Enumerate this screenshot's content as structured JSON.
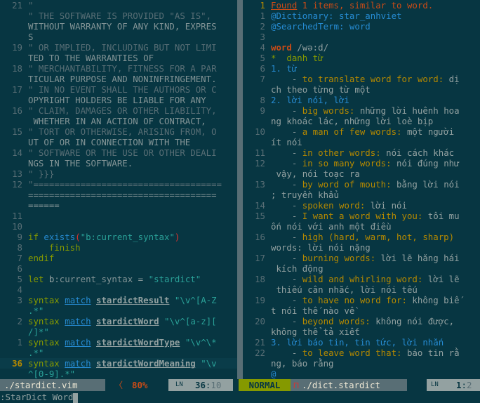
{
  "left": {
    "lines": [
      {
        "n": "21",
        "t": "\""
      },
      {
        "n": "",
        "t": "\" THE SOFTWARE IS PROVIDED \"AS IS\", "
      },
      {
        "n": "",
        "t": "WITHOUT WARRANTY OF ANY KIND, EXPRES"
      },
      {
        "n": "",
        "t": "S"
      },
      {
        "n": "19",
        "t": "\" OR IMPLIED, INCLUDING BUT NOT LIMI"
      },
      {
        "n": "",
        "t": "TED TO THE WARRANTIES OF"
      },
      {
        "n": "18",
        "t": "\" MERCHANTABILITY, FITNESS FOR A PAR"
      },
      {
        "n": "",
        "t": "TICULAR PURPOSE AND NONINFRINGEMENT."
      },
      {
        "n": "17",
        "t": "\" IN NO EVENT SHALL THE AUTHORS OR C"
      },
      {
        "n": "",
        "t": "OPYRIGHT HOLDERS BE LIABLE FOR ANY"
      },
      {
        "n": "16",
        "t": "\" CLAIM, DAMAGES OR OTHER LIABILITY,"
      },
      {
        "n": "",
        "t": " WHETHER IN AN ACTION OF CONTRACT,"
      },
      {
        "n": "15",
        "t": "\" TORT OR OTHERWISE, ARISING FROM, O"
      },
      {
        "n": "",
        "t": "UT OF OR IN CONNECTION WITH THE"
      },
      {
        "n": "14",
        "t": "\" SOFTWARE OR THE USE OR OTHER DEALI"
      },
      {
        "n": "",
        "t": "NGS IN THE SOFTWARE."
      },
      {
        "n": "13",
        "t": "\" }}}"
      },
      {
        "n": "12",
        "t": "\"===================================="
      },
      {
        "n": "",
        "t": "===================================="
      },
      {
        "n": "",
        "t": "======"
      },
      {
        "n": "11",
        "t": ""
      },
      {
        "n": "10",
        "t": ""
      },
      {
        "n": "9",
        "t": "if exists(\"b:current_syntax\")"
      },
      {
        "n": "8",
        "t": "    finish"
      },
      {
        "n": "7",
        "t": "endif"
      },
      {
        "n": "6",
        "t": ""
      },
      {
        "n": "5",
        "t": "let b:current_syntax = \"stardict\""
      },
      {
        "n": "4",
        "t": ""
      },
      {
        "n": "3",
        "t": "syntax match stardictResult \"\\v^[A-Z"
      },
      {
        "n": "",
        "t": ".*\""
      },
      {
        "n": "2",
        "t": "syntax match stardictWord \"\\v^[a-z]["
      },
      {
        "n": "",
        "t": "/]*\""
      },
      {
        "n": "1",
        "t": "syntax match stardictWordType \"\\v^\\*"
      },
      {
        "n": "",
        "t": ".*\""
      },
      {
        "n": "36",
        "t": "syntax match stardictWordMeaning \"\\v"
      },
      {
        "n": "",
        "t": "^[0-9].*\""
      }
    ]
  },
  "right": {
    "lines": [
      {
        "n": "1",
        "t": "Found 1 items, similar to word."
      },
      {
        "n": "1",
        "t": "@Dictionary: star_anhviet"
      },
      {
        "n": "2",
        "t": "@SearchedTerm: word"
      },
      {
        "n": "3",
        "t": ""
      },
      {
        "n": "4",
        "t": "word /wə:d/"
      },
      {
        "n": "5",
        "t": "*  danh từ"
      },
      {
        "n": "6",
        "t": "1. từ"
      },
      {
        "n": "7",
        "t": "    - to translate word for word: dị"
      },
      {
        "n": "",
        "t": "ch theo từng từ một"
      },
      {
        "n": "8",
        "t": "2. lời nói, lời"
      },
      {
        "n": "9",
        "t": "    - big words: những lời huênh hoa"
      },
      {
        "n": "",
        "t": "ng khoác lác, những lời loè bịp"
      },
      {
        "n": "10",
        "t": "    - a man of few words: một người"
      },
      {
        "n": "",
        "t": "ít nói"
      },
      {
        "n": "11",
        "t": "    - in other words: nói cách khác"
      },
      {
        "n": "12",
        "t": "    - in so many words: nói đúng như"
      },
      {
        "n": "",
        "t": " vậy, nói toạc ra"
      },
      {
        "n": "13",
        "t": "    - by word of mouth: bằng lời nói"
      },
      {
        "n": "",
        "t": "; truyền khẩu"
      },
      {
        "n": "14",
        "t": "    - spoken word: lời nói"
      },
      {
        "n": "15",
        "t": "    - I want a word with you: tôi mu"
      },
      {
        "n": "",
        "t": "ốn nói với anh một điều"
      },
      {
        "n": "16",
        "t": "    - high (hard, warm, hot, sharp)"
      },
      {
        "n": "",
        "t": "words: lời nói nặng"
      },
      {
        "n": "17",
        "t": "    - burning words: lời lẽ hăng hái"
      },
      {
        "n": "",
        "t": " kích động"
      },
      {
        "n": "18",
        "t": "    - wild and whirling word: lời lẽ"
      },
      {
        "n": "",
        "t": " thiếu cân nhắc, lời nói tếu"
      },
      {
        "n": "19",
        "t": "    - to have no word for: không biế"
      },
      {
        "n": "",
        "t": "t nói thế nào về"
      },
      {
        "n": "20",
        "t": "    - beyond words: không nói được,"
      },
      {
        "n": "",
        "t": "không thể tả xiết"
      },
      {
        "n": "21",
        "t": "3. lời báo tin, tin tức, lời nhắn"
      },
      {
        "n": "22",
        "t": "    - to leave word that: báo tin rằ"
      },
      {
        "n": "",
        "t": "ng, báo rằng"
      },
      {
        "n": "",
        "t": "@"
      }
    ]
  },
  "statusbar": {
    "left_file": "./stardict.vim",
    "left_percent": "80%",
    "left_ln": "LN",
    "left_pos_line": "36",
    "left_pos_col": "10",
    "mode": "NORMAL",
    "right_file": "./dict.stardict",
    "right_ln": "LN",
    "right_pos_line": "1",
    "right_pos_col": "2"
  },
  "command_line": ":StarDict Word",
  "colors": {
    "bg": "#073642",
    "accent": "#859900",
    "orange": "#cb4b16",
    "blue": "#268bd2",
    "cyan": "#2aa198",
    "yellow": "#b58900"
  }
}
